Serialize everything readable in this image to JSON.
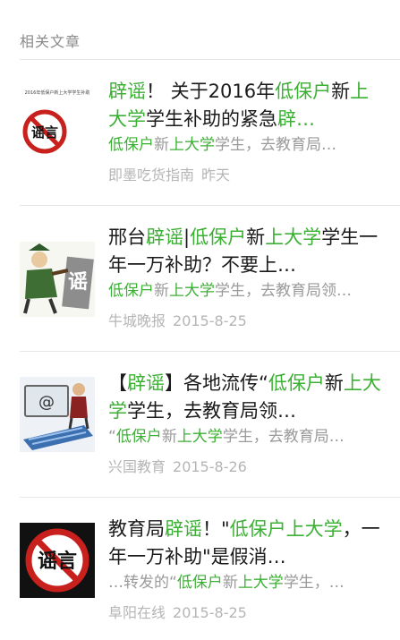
{
  "header": {
    "title": "相关文章"
  },
  "colors": {
    "highlight": "#3cb034",
    "meta": "#b5b5b5",
    "excerpt": "#9a9a9a",
    "divider": "#e6e6e6"
  },
  "articles": [
    {
      "thumb_icon": "rumor-stamp-thumbnail",
      "thumb_caption": "2016年低保户新上大学学生补助",
      "thumb_text": "谣言",
      "title": [
        {
          "t": "辟谣",
          "hl": true
        },
        {
          "t": "！ 关于2016年",
          "hl": false
        },
        {
          "t": "低保户",
          "hl": true
        },
        {
          "t": "新",
          "hl": false
        },
        {
          "t": "上大学",
          "hl": true
        },
        {
          "t": "学生补助的紧急",
          "hl": false
        },
        {
          "t": "辟…",
          "hl": true
        }
      ],
      "excerpt": [
        {
          "t": "低保户",
          "hl": true
        },
        {
          "t": "新",
          "hl": false
        },
        {
          "t": "上大学",
          "hl": true
        },
        {
          "t": "学生，去教育局…",
          "hl": false
        }
      ],
      "source": "即墨吃货指南",
      "date": "昨天"
    },
    {
      "thumb_icon": "cartoon-thumbnail",
      "thumb_caption": "",
      "thumb_text": "谣",
      "title": [
        {
          "t": "邢台",
          "hl": false
        },
        {
          "t": "辟谣",
          "hl": true
        },
        {
          "t": "|",
          "hl": false
        },
        {
          "t": "低保户",
          "hl": true
        },
        {
          "t": "新",
          "hl": false
        },
        {
          "t": "上大学",
          "hl": true
        },
        {
          "t": "学生一年一万补助？不要上…",
          "hl": false
        }
      ],
      "excerpt": [
        {
          "t": "低保户",
          "hl": true
        },
        {
          "t": "新",
          "hl": false
        },
        {
          "t": "上大学",
          "hl": true
        },
        {
          "t": "学生，去教育局领…",
          "hl": false
        }
      ],
      "source": "牛城晚报",
      "date": "2015-8-25"
    },
    {
      "thumb_icon": "computer-email-thumbnail",
      "thumb_caption": "",
      "thumb_text": "@",
      "title": [
        {
          "t": "【",
          "hl": false
        },
        {
          "t": "辟谣",
          "hl": true
        },
        {
          "t": "】各地流传“",
          "hl": false
        },
        {
          "t": "低保户",
          "hl": true
        },
        {
          "t": "新",
          "hl": false
        },
        {
          "t": "上大学",
          "hl": true
        },
        {
          "t": "学生，去教育局领…",
          "hl": false
        }
      ],
      "excerpt": [
        {
          "t": "“",
          "hl": false
        },
        {
          "t": "低保户",
          "hl": true
        },
        {
          "t": "新",
          "hl": false
        },
        {
          "t": "上大学",
          "hl": true
        },
        {
          "t": "学生，去教育局…",
          "hl": false
        }
      ],
      "source": "兴国教育",
      "date": "2015-8-26"
    },
    {
      "thumb_icon": "rumor-stamp-thumbnail",
      "thumb_caption": "",
      "thumb_text": "谣言",
      "title": [
        {
          "t": "教育局",
          "hl": false
        },
        {
          "t": "辟谣",
          "hl": true
        },
        {
          "t": "！\"",
          "hl": false
        },
        {
          "t": "低保户上大学",
          "hl": true
        },
        {
          "t": "，一年一万补助\"是假消…",
          "hl": false
        }
      ],
      "excerpt": [
        {
          "t": "…转发的“",
          "hl": false
        },
        {
          "t": "低保户",
          "hl": true
        },
        {
          "t": "新",
          "hl": false
        },
        {
          "t": "上大学",
          "hl": true
        },
        {
          "t": "学生，…",
          "hl": false
        }
      ],
      "source": "阜阳在线",
      "date": "2015-8-25"
    }
  ]
}
